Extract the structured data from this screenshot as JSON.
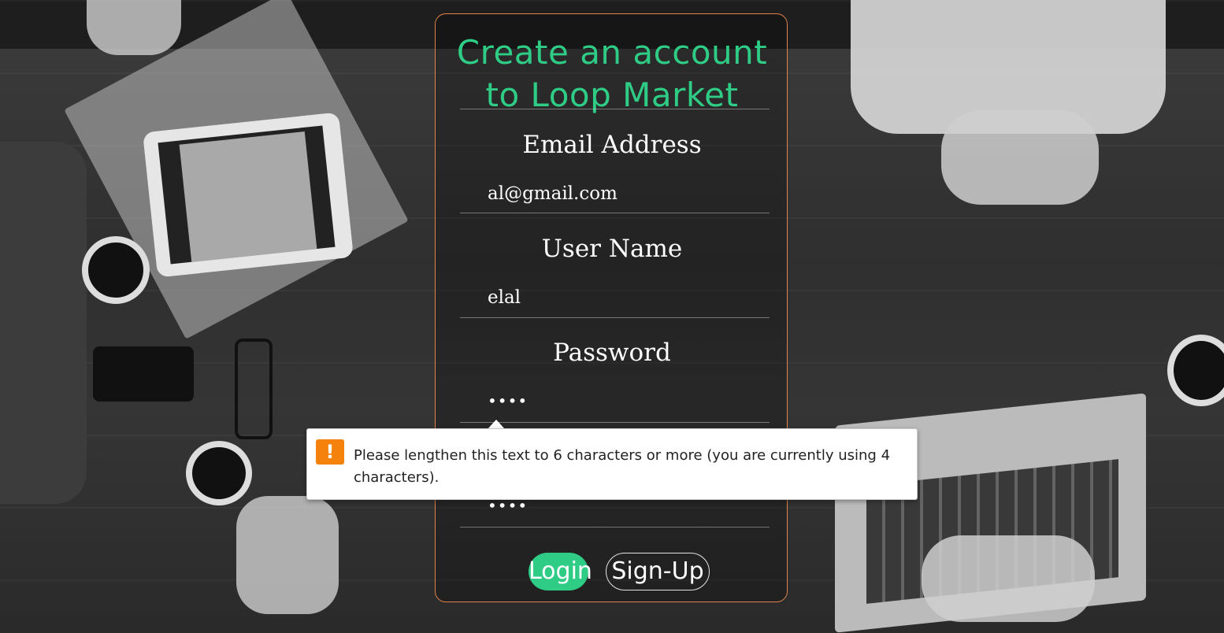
{
  "form": {
    "title": "Create an account to Loop Market",
    "email": {
      "label": "Email Address",
      "value": "al@gmail.com"
    },
    "username": {
      "label": "User Name",
      "value": "elal"
    },
    "password": {
      "label": "Password",
      "value": "••••"
    },
    "confirm_password": {
      "value": "••••"
    },
    "login_button": "Login",
    "signup_button": "Sign-Up"
  },
  "validation_tooltip": {
    "icon": "warning-icon",
    "message": "Please lengthen this text to 6 characters or more (you are currently using 4 characters).",
    "icon_color": "#f5820d"
  },
  "colors": {
    "accent": "#2ecc85",
    "card_border": "#e0844a"
  }
}
